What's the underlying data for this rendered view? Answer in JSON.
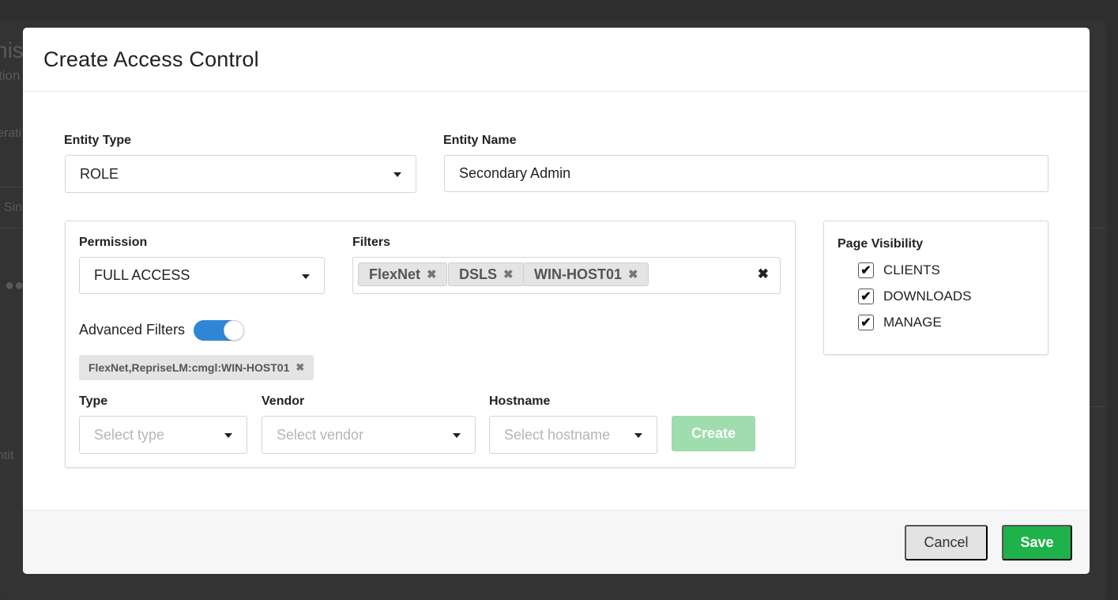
{
  "background": {
    "fragments": [
      "nist",
      "tion",
      "erati",
      "Sin",
      "ntit"
    ]
  },
  "modal": {
    "title": "Create Access Control"
  },
  "entity_type": {
    "label": "Entity Type",
    "value": "ROLE"
  },
  "entity_name": {
    "label": "Entity Name",
    "value": "Secondary Admin"
  },
  "permission": {
    "label": "Permission",
    "value": "FULL ACCESS"
  },
  "filters": {
    "label": "Filters",
    "tags": [
      "FlexNet",
      "DSLS",
      "WIN-HOST01"
    ]
  },
  "advanced_filters": {
    "label": "Advanced Filters",
    "enabled": true,
    "chips": [
      "FlexNet,RepriseLM:cmgl:WIN-HOST01"
    ],
    "type": {
      "label": "Type",
      "placeholder": "Select type"
    },
    "vendor": {
      "label": "Vendor",
      "placeholder": "Select vendor"
    },
    "hostname": {
      "label": "Hostname",
      "placeholder": "Select hostname"
    },
    "create_label": "Create"
  },
  "page_visibility": {
    "label": "Page Visibility",
    "items": [
      {
        "label": "CLIENTS",
        "checked": true
      },
      {
        "label": "DOWNLOADS",
        "checked": true
      },
      {
        "label": "MANAGE",
        "checked": true
      }
    ]
  },
  "footer": {
    "cancel_label": "Cancel",
    "save_label": "Save"
  },
  "colors": {
    "save": "#1fb24a",
    "create_disabled": "#9fdcae",
    "toggle_on": "#2f86d6"
  }
}
